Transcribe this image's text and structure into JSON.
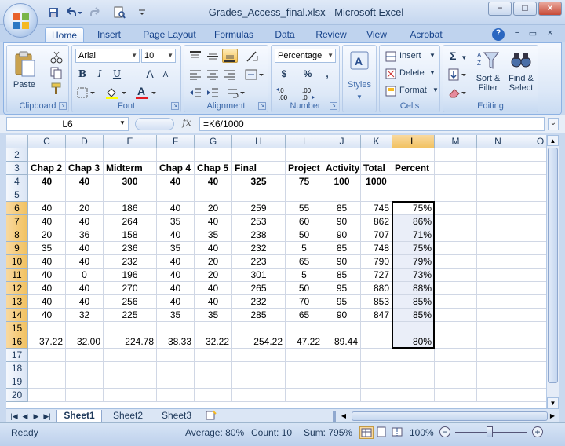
{
  "window": {
    "title": "Grades_Access_final.xlsx - Microsoft Excel",
    "minimize": "−",
    "maximize": "□",
    "close": "×",
    "doc_min": "−",
    "doc_restore": "▭",
    "doc_close": "×",
    "help": "?"
  },
  "tabs": [
    "Home",
    "Insert",
    "Page Layout",
    "Formulas",
    "Data",
    "Review",
    "View",
    "Acrobat"
  ],
  "ribbon": {
    "clipboard": {
      "label": "Clipboard",
      "paste": "Paste"
    },
    "font": {
      "label": "Font",
      "name": "Arial",
      "size": "10",
      "bold": "B",
      "italic": "I",
      "underline": "U",
      "grow": "A",
      "shrink": "A",
      "color_letter": "A"
    },
    "alignment": {
      "label": "Alignment"
    },
    "number": {
      "label": "Number",
      "format": "Percentage",
      "currency": "$",
      "percent": "%",
      "comma": ",",
      "inc_dec": ".0\n.00",
      "dec_dec": ".00\n.0"
    },
    "styles": {
      "label": "Styles"
    },
    "cells": {
      "label": "Cells",
      "insert": "Insert",
      "delete": "Delete",
      "format": "Format"
    },
    "editing": {
      "label": "Editing",
      "sigma": "Σ",
      "sort": "Sort &",
      "sort2": "Filter",
      "find": "Find &",
      "find2": "Select"
    }
  },
  "formula_bar": {
    "name_box": "L6",
    "fx": "fx",
    "formula": "=K6/1000"
  },
  "columns": [
    "C",
    "D",
    "E",
    "F",
    "G",
    "H",
    "I",
    "J",
    "K",
    "L",
    "M",
    "N",
    "O"
  ],
  "rows": [
    {
      "num": "2",
      "cells": [
        "",
        "",
        "",
        "",
        "",
        "",
        "",
        "",
        "",
        "",
        "",
        "",
        ""
      ]
    },
    {
      "num": "3",
      "cells": [
        "Chap 2",
        "Chap 3",
        "Midterm",
        "Chap 4",
        "Chap 5",
        "Final",
        "Project",
        "Activity",
        "Total",
        "Percent",
        "",
        "",
        ""
      ]
    },
    {
      "num": "4",
      "cells": [
        "40",
        "40",
        "300",
        "40",
        "40",
        "325",
        "75",
        "100",
        "1000",
        "",
        "",
        "",
        ""
      ]
    },
    {
      "num": "5",
      "cells": [
        "",
        "",
        "",
        "",
        "",
        "",
        "",
        "",
        "",
        "",
        "",
        "",
        ""
      ]
    },
    {
      "num": "6",
      "cells": [
        "40",
        "20",
        "186",
        "40",
        "20",
        "259",
        "55",
        "85",
        "745",
        "75%",
        "",
        "",
        ""
      ]
    },
    {
      "num": "7",
      "cells": [
        "40",
        "40",
        "264",
        "35",
        "40",
        "253",
        "60",
        "90",
        "862",
        "86%",
        "",
        "",
        ""
      ]
    },
    {
      "num": "8",
      "cells": [
        "20",
        "36",
        "158",
        "40",
        "35",
        "238",
        "50",
        "90",
        "707",
        "71%",
        "",
        "",
        ""
      ]
    },
    {
      "num": "9",
      "cells": [
        "35",
        "40",
        "236",
        "35",
        "40",
        "232",
        "5",
        "85",
        "748",
        "75%",
        "",
        "",
        ""
      ]
    },
    {
      "num": "10",
      "cells": [
        "40",
        "40",
        "232",
        "40",
        "20",
        "223",
        "65",
        "90",
        "790",
        "79%",
        "",
        "",
        ""
      ]
    },
    {
      "num": "11",
      "cells": [
        "40",
        "0",
        "196",
        "40",
        "20",
        "301",
        "5",
        "85",
        "727",
        "73%",
        "",
        "",
        ""
      ]
    },
    {
      "num": "12",
      "cells": [
        "40",
        "40",
        "270",
        "40",
        "40",
        "265",
        "50",
        "95",
        "880",
        "88%",
        "",
        "",
        ""
      ]
    },
    {
      "num": "13",
      "cells": [
        "40",
        "40",
        "256",
        "40",
        "40",
        "232",
        "70",
        "95",
        "853",
        "85%",
        "",
        "",
        ""
      ]
    },
    {
      "num": "14",
      "cells": [
        "40",
        "32",
        "225",
        "35",
        "35",
        "285",
        "65",
        "90",
        "847",
        "85%",
        "",
        "",
        ""
      ]
    },
    {
      "num": "15",
      "cells": [
        "",
        "",
        "",
        "",
        "",
        "",
        "",
        "",
        "",
        "",
        "",
        "",
        ""
      ]
    },
    {
      "num": "16",
      "cells": [
        "37.22",
        "32.00",
        "224.78",
        "38.33",
        "32.22",
        "254.22",
        "47.22",
        "89.44",
        "",
        "80%",
        "",
        "",
        ""
      ]
    },
    {
      "num": "17",
      "cells": [
        "",
        "",
        "",
        "",
        "",
        "",
        "",
        "",
        "",
        "",
        "",
        "",
        ""
      ]
    },
    {
      "num": "18",
      "cells": [
        "",
        "",
        "",
        "",
        "",
        "",
        "",
        "",
        "",
        "",
        "",
        "",
        ""
      ]
    },
    {
      "num": "19",
      "cells": [
        "",
        "",
        "",
        "",
        "",
        "",
        "",
        "",
        "",
        "",
        "",
        "",
        ""
      ]
    },
    {
      "num": "20",
      "cells": [
        "",
        "",
        "",
        "",
        "",
        "",
        "",
        "",
        "",
        "",
        "",
        "",
        ""
      ]
    }
  ],
  "sheets": [
    "Sheet1",
    "Sheet2",
    "Sheet3"
  ],
  "status": {
    "ready": "Ready",
    "average": "Average: 80%",
    "count": "Count: 10",
    "sum": "Sum: 795%",
    "zoom": "100%",
    "zoom_minus": "−",
    "zoom_plus": "+"
  }
}
